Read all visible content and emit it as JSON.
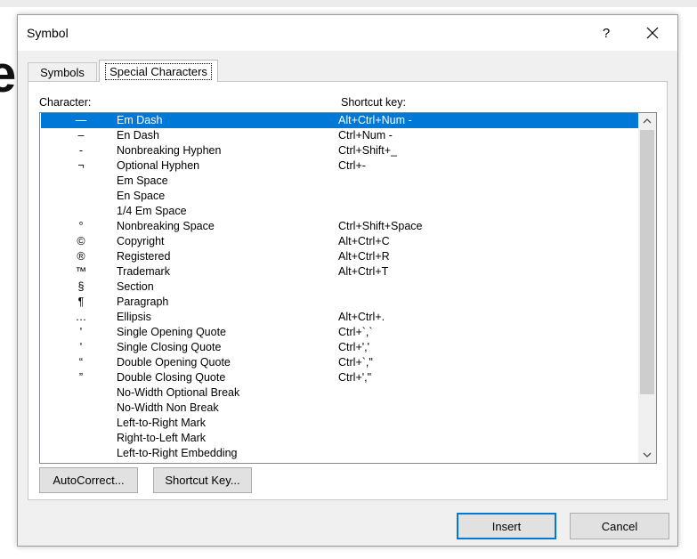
{
  "background": {
    "glyph": "e"
  },
  "dialog": {
    "title": "Symbol",
    "help_label": "?",
    "close_icon": "close-icon"
  },
  "tabs": [
    {
      "label": "Symbols",
      "active": false
    },
    {
      "label": "Special Characters",
      "active": true
    }
  ],
  "list": {
    "header_character": "Character:",
    "header_shortcut": "Shortcut key:",
    "selected_index": 0,
    "rows": [
      {
        "glyph": "—",
        "name": "Em Dash",
        "shortcut": "Alt+Ctrl+Num -"
      },
      {
        "glyph": "–",
        "name": "En Dash",
        "shortcut": "Ctrl+Num -"
      },
      {
        "glyph": "-",
        "name": "Nonbreaking Hyphen",
        "shortcut": "Ctrl+Shift+_"
      },
      {
        "glyph": "¬",
        "name": "Optional Hyphen",
        "shortcut": "Ctrl+-"
      },
      {
        "glyph": "",
        "name": "Em Space",
        "shortcut": ""
      },
      {
        "glyph": "",
        "name": "En Space",
        "shortcut": ""
      },
      {
        "glyph": "",
        "name": "1/4 Em Space",
        "shortcut": ""
      },
      {
        "glyph": "°",
        "name": "Nonbreaking Space",
        "shortcut": "Ctrl+Shift+Space"
      },
      {
        "glyph": "©",
        "name": "Copyright",
        "shortcut": "Alt+Ctrl+C"
      },
      {
        "glyph": "®",
        "name": "Registered",
        "shortcut": "Alt+Ctrl+R"
      },
      {
        "glyph": "™",
        "name": "Trademark",
        "shortcut": "Alt+Ctrl+T"
      },
      {
        "glyph": "§",
        "name": "Section",
        "shortcut": ""
      },
      {
        "glyph": "¶",
        "name": "Paragraph",
        "shortcut": ""
      },
      {
        "glyph": "…",
        "name": "Ellipsis",
        "shortcut": "Alt+Ctrl+."
      },
      {
        "glyph": "'",
        "name": "Single Opening Quote",
        "shortcut": "Ctrl+`,`"
      },
      {
        "glyph": "'",
        "name": "Single Closing Quote",
        "shortcut": "Ctrl+','"
      },
      {
        "glyph": "“",
        "name": "Double Opening Quote",
        "shortcut": "Ctrl+`,\""
      },
      {
        "glyph": "”",
        "name": "Double Closing Quote",
        "shortcut": "Ctrl+',\""
      },
      {
        "glyph": "",
        "name": "No-Width Optional Break",
        "shortcut": ""
      },
      {
        "glyph": "",
        "name": "No-Width Non Break",
        "shortcut": ""
      },
      {
        "glyph": "",
        "name": "Left-to-Right Mark",
        "shortcut": ""
      },
      {
        "glyph": "",
        "name": "Right-to-Left Mark",
        "shortcut": ""
      },
      {
        "glyph": "",
        "name": "Left-to-Right Embedding",
        "shortcut": ""
      }
    ]
  },
  "buttons": {
    "autocorrect": "AutoCorrect...",
    "shortcut_key": "Shortcut Key...",
    "insert": "Insert",
    "cancel": "Cancel"
  },
  "colors": {
    "selection": "#0078d7",
    "default_button_border": "#0078d7"
  }
}
